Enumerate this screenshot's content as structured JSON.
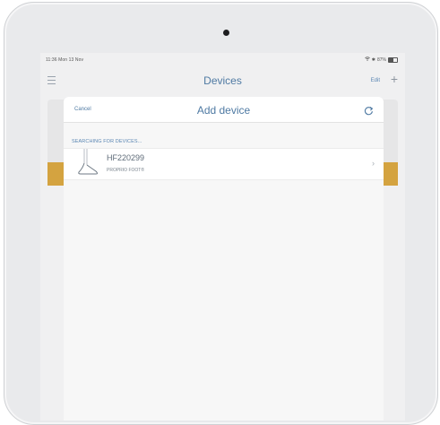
{
  "status_bar": {
    "time": "11:36",
    "date": "Mon 13 Nov",
    "battery_percent": "87%",
    "battery_level": 0.87
  },
  "nav_bar": {
    "title": "Devices",
    "edit_label": "Edit",
    "add_label": "+",
    "menu_icon": "hamburger-icon"
  },
  "modal": {
    "cancel_label": "Cancel",
    "title": "Add device",
    "refresh_icon": "refresh-icon",
    "section_label": "SEARCHING FOR DEVICES...",
    "devices": [
      {
        "name": "HF220299",
        "type": "PROPRIO FOOT®",
        "icon": "prosthetic-foot-icon"
      }
    ]
  },
  "colors": {
    "accent": "#4f7aa3",
    "highlight": "#d4a340",
    "screen_bg": "#f0f0f1"
  }
}
